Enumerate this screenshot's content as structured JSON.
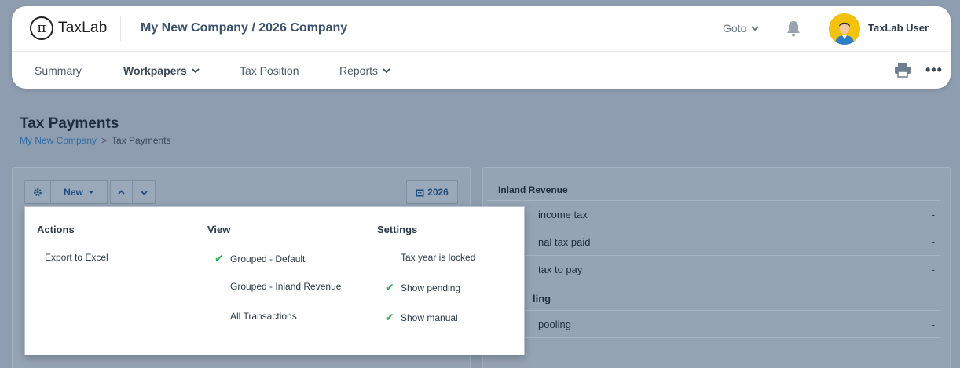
{
  "header": {
    "logo_symbol": "π",
    "logo_text": "TaxLab",
    "company": "My New Company / 2026 Company",
    "goto_label": "Goto",
    "user_name": "TaxLab User"
  },
  "nav": {
    "summary": "Summary",
    "workpapers": "Workpapers",
    "tax_position": "Tax Position",
    "reports": "Reports",
    "more": "•••"
  },
  "page": {
    "title": "Tax Payments",
    "breadcrumb": {
      "company": "My New Company",
      "separator": ">",
      "current": "Tax Payments"
    }
  },
  "toolbar": {
    "new_label": "New",
    "year_label": "2026"
  },
  "dropdown": {
    "actions_heading": "Actions",
    "view_heading": "View",
    "settings_heading": "Settings",
    "actions": [
      "Export to Excel"
    ],
    "view": [
      {
        "label": "Grouped - Default",
        "checked": true
      },
      {
        "label": "Grouped - Inland Revenue",
        "checked": false
      },
      {
        "label": "All Transactions",
        "checked": false
      }
    ],
    "settings": [
      {
        "label": "Tax year is locked",
        "checked": false
      },
      {
        "label": "Show pending",
        "checked": true
      },
      {
        "label": "Show manual",
        "checked": true
      }
    ]
  },
  "right_panel": {
    "section1": "Inland Revenue",
    "rows": [
      {
        "label": "income tax",
        "value": "-"
      },
      {
        "label": "nal tax paid",
        "value": "-"
      },
      {
        "label": "tax to pay",
        "value": "-"
      }
    ],
    "section2": "ling",
    "rows2": [
      {
        "label": "pooling",
        "value": "-"
      }
    ]
  },
  "colors": {
    "accent": "#2e6da4",
    "check": "#2fae4e",
    "overlay": "#8e9eb0"
  }
}
